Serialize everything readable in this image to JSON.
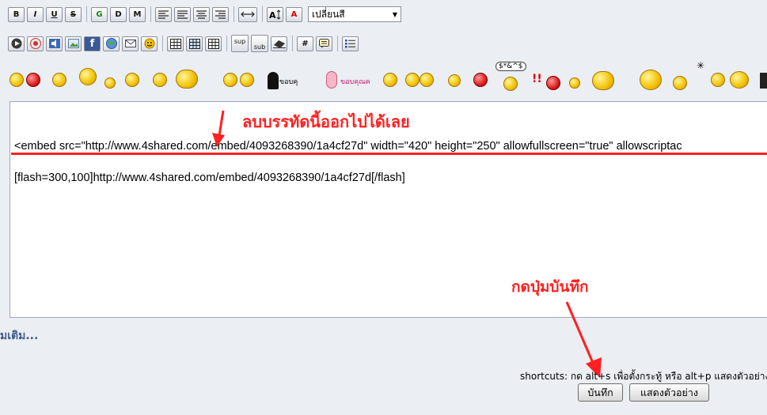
{
  "toolbar1": {
    "bold": "B",
    "italic": "I",
    "underline": "U",
    "strike": "S",
    "font_g": "G",
    "font_d": "D",
    "font_m": "M",
    "color_a": "A",
    "color_select": "เปลี่ยนสี"
  },
  "toolbar2": {
    "sup": "sup",
    "sub": "sub",
    "hash": "#"
  },
  "smileys": {
    "thanks1": "ขอบคุ",
    "thanks2": "ขอบคุณค",
    "symbols": "$*&^$"
  },
  "editor": {
    "line1": "<embed src=\"http://www.4shared.com/embed/4093268390/1a4cf27d\" width=\"420\" height=\"250\" allowfullscreen=\"true\" allowscriptac",
    "line2": "[flash=300,100]http://www.4shared.com/embed/4093268390/1a4cf27d[/flash]"
  },
  "annotations": {
    "delete_line": "ลบบรรทัดนี้ออกไปได้เลย",
    "press_save": "กดปุ่มบันทึก"
  },
  "more_link": "มเติม...",
  "shortcuts": "shortcuts: กด alt+s เพื่อตั้งกระทู้ หรือ alt+p แสดงตัวอย่าง",
  "buttons": {
    "save": "บันทึก",
    "preview": "แสดงตัวอย่าง"
  },
  "colors": {
    "annotation": "#ff2020",
    "link": "#3c5a8a"
  }
}
